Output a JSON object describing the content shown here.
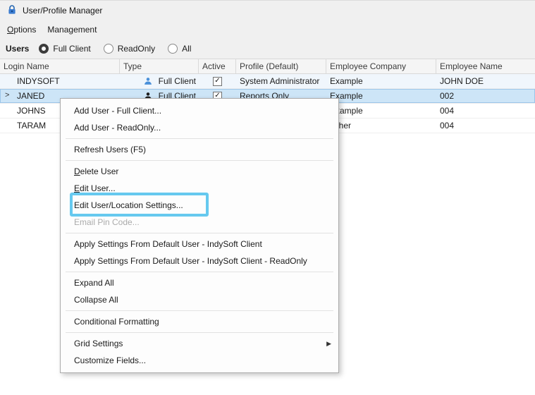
{
  "window": {
    "title": "User/Profile Manager"
  },
  "menubar": {
    "items": [
      {
        "label": "Options",
        "underline_first": true
      },
      {
        "label": "Management",
        "underline_first": false
      }
    ]
  },
  "filter": {
    "label": "Users",
    "options": [
      {
        "label": "Full Client",
        "selected": true
      },
      {
        "label": "ReadOnly",
        "selected": false
      },
      {
        "label": "All",
        "selected": false
      }
    ]
  },
  "grid": {
    "columns": [
      "Login Name",
      "Type",
      "Active",
      "Profile (Default)",
      "Employee Company",
      "Employee Name"
    ],
    "rows": [
      {
        "login": "INDYSOFT",
        "type": "Full Client",
        "type_icon": "user-icon",
        "type_icon_color": "#4a90d9",
        "active": true,
        "profile": "System Administrator",
        "company": "Example",
        "name": "JOHN DOE",
        "selected": false
      },
      {
        "login": "JANED",
        "type": "Full Client",
        "type_icon": "user-icon",
        "type_icon_color": "#1f1f1f",
        "active": true,
        "profile": "Reports Only",
        "company": "Example",
        "name": "002",
        "selected": true
      },
      {
        "login": "JOHNS",
        "type": "",
        "active": null,
        "profile": "",
        "company": "Example",
        "name": "004",
        "selected": false
      },
      {
        "login": "TARAM",
        "type": "",
        "active": null,
        "profile": "",
        "company": "Other",
        "name": "004",
        "selected": false
      }
    ]
  },
  "context_menu": {
    "items": [
      {
        "type": "item",
        "label": "Add User - Full Client..."
      },
      {
        "type": "item",
        "label": "Add User - ReadOnly..."
      },
      {
        "type": "separator"
      },
      {
        "type": "item",
        "label": "Refresh Users (F5)"
      },
      {
        "type": "separator"
      },
      {
        "type": "item",
        "label": "Delete User",
        "underline_first": true
      },
      {
        "type": "item",
        "label": "Edit User...",
        "underline_first": true
      },
      {
        "type": "item",
        "label": "Edit User/Location Settings...",
        "highlighted": true
      },
      {
        "type": "item",
        "label": "Email Pin Code...",
        "disabled": true
      },
      {
        "type": "separator"
      },
      {
        "type": "item",
        "label": "Apply Settings From Default User - IndySoft Client"
      },
      {
        "type": "item",
        "label": "Apply Settings From Default User - IndySoft Client - ReadOnly"
      },
      {
        "type": "separator"
      },
      {
        "type": "item",
        "label": "Expand All"
      },
      {
        "type": "item",
        "label": "Collapse All"
      },
      {
        "type": "separator"
      },
      {
        "type": "item",
        "label": "Conditional Formatting"
      },
      {
        "type": "separator"
      },
      {
        "type": "item",
        "label": "Grid Settings",
        "submenu": true
      },
      {
        "type": "item",
        "label": "Customize Fields..."
      }
    ]
  },
  "annotation": {
    "highlight_color": "#66c9ef"
  }
}
